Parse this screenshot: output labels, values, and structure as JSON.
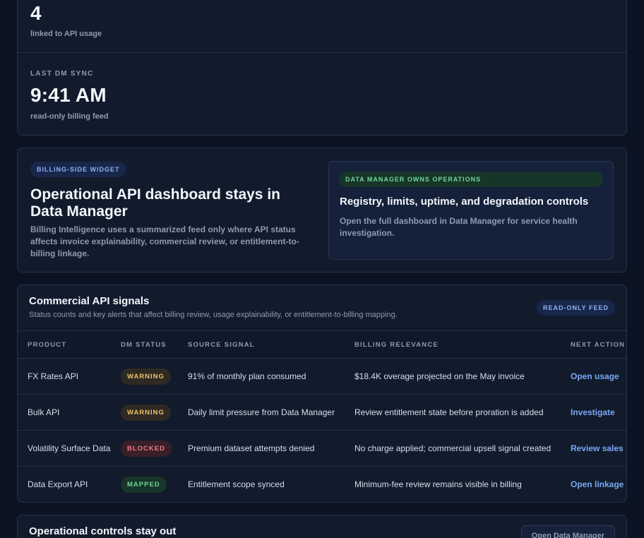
{
  "metrics": [
    {
      "label": "",
      "value": "4",
      "sub": "linked to API usage"
    },
    {
      "label": "LAST DM SYNC",
      "value": "9:41 AM",
      "sub": "read-only billing feed"
    }
  ],
  "widget": {
    "badge": "BILLING-SIDE WIDGET",
    "title": "Operational API dashboard stays in Data Manager",
    "description": "Billing Intelligence uses a summarized feed only where API status affects invoice explainability, commercial review, or entitlement-to-billing linkage.",
    "owner_card": {
      "badge": "DATA MANAGER OWNS OPERATIONS",
      "title": "Registry, limits, uptime, and degradation controls",
      "description": "Open the full dashboard in Data Manager for service health investigation."
    }
  },
  "signals": {
    "title": "Commercial API signals",
    "subtitle": "Status counts and key alerts that affect billing review, usage explainability, or entitlement-to-billing mapping.",
    "feed_badge": "READ-ONLY FEED",
    "columns": [
      "PRODUCT",
      "DM STATUS",
      "SOURCE SIGNAL",
      "BILLING RELEVANCE",
      "NEXT ACTION"
    ],
    "rows": [
      {
        "product": "FX Rates API",
        "status": "WARNING",
        "signal": "91% of monthly plan consumed",
        "relevance": "$18.4K overage projected on the May invoice",
        "action": "Open usage"
      },
      {
        "product": "Bulk API",
        "status": "WARNING",
        "signal": "Daily limit pressure from Data Manager",
        "relevance": "Review entitlement state before proration is added",
        "action": "Investigate"
      },
      {
        "product": "Volatility Surface Data",
        "status": "BLOCKED",
        "signal": "Premium dataset attempts denied",
        "relevance": "No charge applied; commercial upsell signal created",
        "action": "Review sales"
      },
      {
        "product": "Data Export API",
        "status": "MAPPED",
        "signal": "Entitlement scope synced",
        "relevance": "Minimum-fee review remains visible in billing",
        "action": "Open linkage"
      }
    ]
  },
  "operations": {
    "title": "Operational controls stay out",
    "button": "Open Data Manager"
  },
  "colors": {
    "background": "#0b1322",
    "card": "#111b2c",
    "accent": "#7aa7f3",
    "warning": "#efc06a",
    "blocked": "#ef7b84",
    "mapped": "#6ed69d"
  }
}
